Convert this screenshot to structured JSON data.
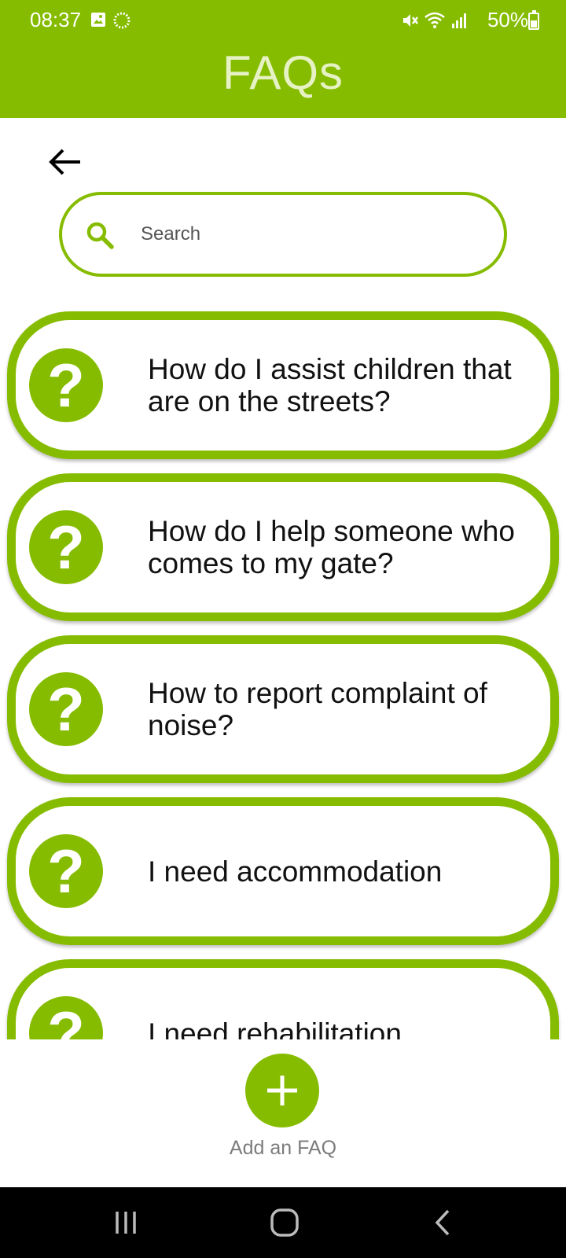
{
  "status_bar": {
    "time": "08:37",
    "battery": "50%",
    "icons": [
      "image-icon",
      "sync-icon",
      "mute-icon",
      "wifi-icon",
      "signal-icon",
      "battery-icon"
    ]
  },
  "header": {
    "title": "FAQs"
  },
  "back": {
    "icon": "arrow-left-icon"
  },
  "search": {
    "placeholder": "Search",
    "value": ""
  },
  "faqs": [
    {
      "question": "How do I assist children that are on the streets?",
      "icon": "question-icon"
    },
    {
      "question": "How do I help someone who comes to my gate?",
      "icon": "question-icon"
    },
    {
      "question": "How to report complaint of noise?",
      "icon": "question-icon"
    },
    {
      "question": "I need accommodation",
      "icon": "question-icon"
    },
    {
      "question": "I need rehabilitation",
      "icon": "question-icon"
    }
  ],
  "add_faq": {
    "label": "Add an FAQ",
    "icon": "plus-icon"
  },
  "nav_bar": {
    "icons": [
      "recent-apps-icon",
      "home-icon",
      "back-icon"
    ]
  },
  "colors": {
    "accent": "#86bc00",
    "title_text": "#e6f2c4",
    "nav_background": "#000000"
  }
}
